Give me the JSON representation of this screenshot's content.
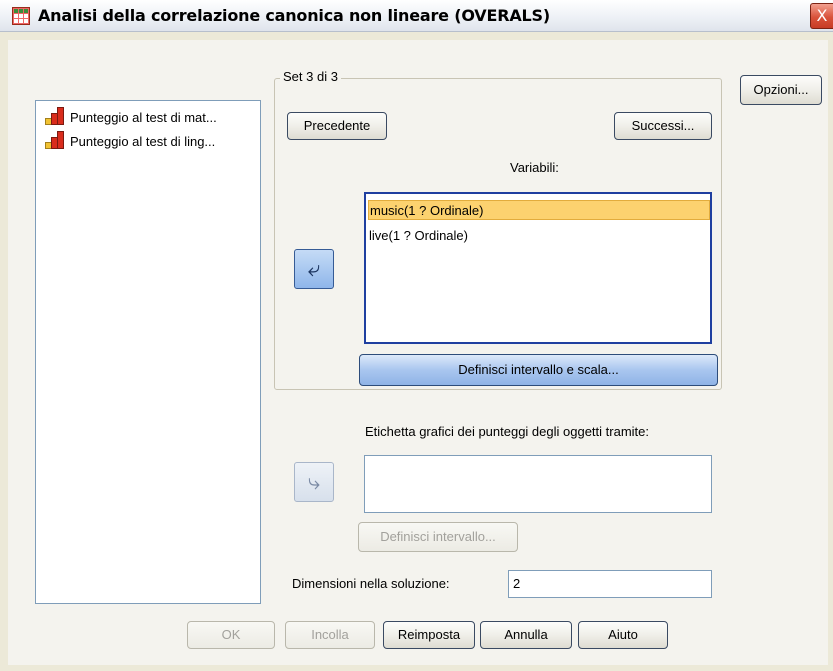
{
  "window": {
    "title": "Analisi della correlazione canonica non lineare (OVERALS)",
    "close_label": "X"
  },
  "source_list": {
    "items": [
      {
        "label": "Punteggio al test di mat...",
        "icon": "scale-measure-icon"
      },
      {
        "label": "Punteggio al test di ling...",
        "icon": "scale-measure-icon"
      }
    ]
  },
  "set_group": {
    "legend": "Set 3 di 3",
    "previous_label": "Precedente",
    "next_label": "Successi...",
    "variables_label": "Variabili:",
    "variables": [
      {
        "label": "music(1 ? Ordinale)",
        "selected": true
      },
      {
        "label": "live(1 ? Ordinale)",
        "selected": false
      }
    ],
    "define_range_scale_label": "Definisci intervallo e scala..."
  },
  "options_label": "Opzioni...",
  "object_label": {
    "label": "Etichetta grafici dei punteggi degli oggetti tramite:",
    "value": "",
    "define_range_label": "Definisci intervallo..."
  },
  "dimensions": {
    "label": "Dimensioni nella soluzione:",
    "value": "2"
  },
  "footer": {
    "ok": "OK",
    "paste": "Incolla",
    "reset": "Reimposta",
    "cancel": "Annulla",
    "help": "Aiuto"
  },
  "colors": {
    "selection": "#fcd26f",
    "accent_blue": "#8fb3e6",
    "close_red": "#d9533b"
  }
}
